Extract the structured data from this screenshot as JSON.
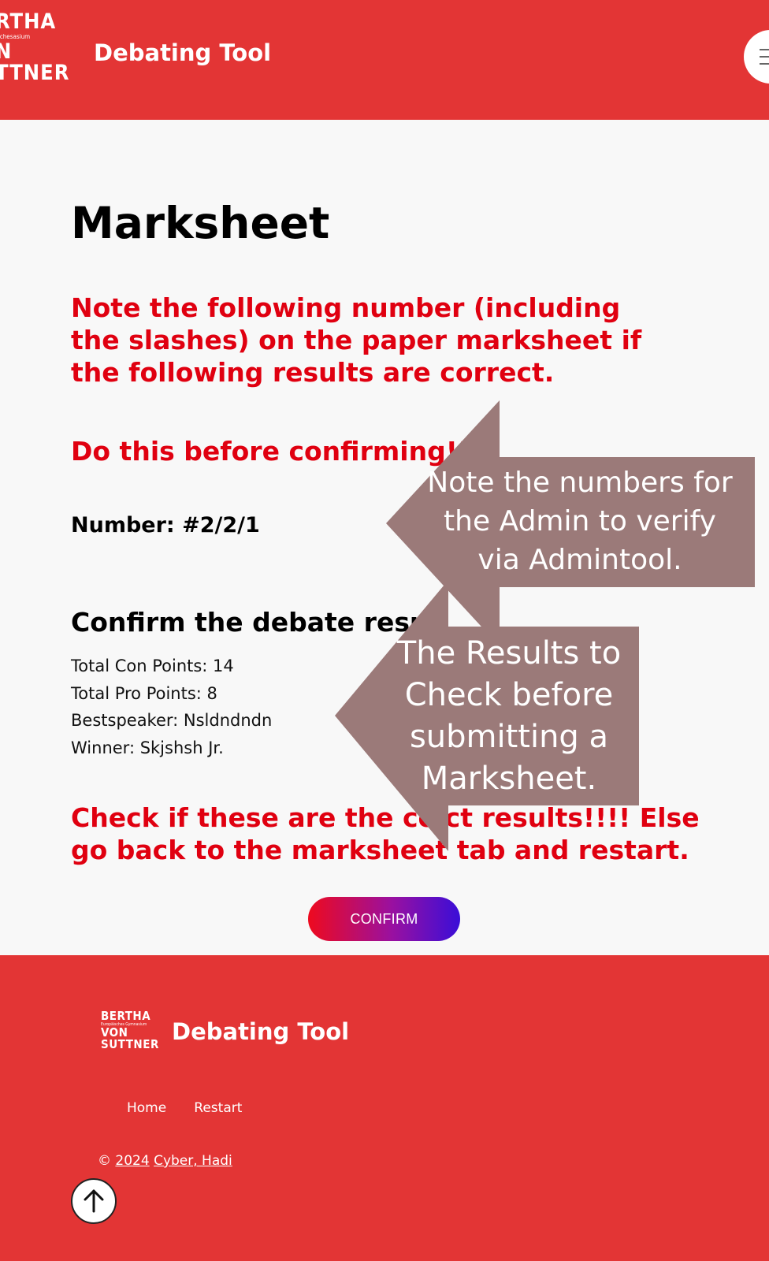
{
  "header": {
    "logo": {
      "line1": "RTHA",
      "line2": "ischesasium",
      "line3": "N",
      "line4": "TTNER"
    },
    "title": "Debating Tool",
    "menu_icon": "hamburger-icon"
  },
  "main": {
    "title": "Marksheet",
    "note_instruction": "Note the following number (including the slashes) on the paper marksheet if the following results are correct.",
    "note_warning": "Do this before confirming!!!",
    "number_label": "Number:",
    "number_value": "#2/2/1",
    "confirm_heading": "Confirm the debate resu",
    "results": [
      "Total Con Points: 14",
      "Total Pro Points: 8",
      "Bestspeaker: Nsldndndn",
      "Winner: Skjshsh Jr."
    ],
    "check_warning": "Check if these are the co ct results!!!! Else go back to the marksheet tab and restart.",
    "confirm_button": "CONFIRM"
  },
  "callouts": [
    {
      "text": "Note the numbers for the Admin to verify via Admintool."
    },
    {
      "text": "The Results to Check before submitting a Marksheet."
    }
  ],
  "footer": {
    "logo": {
      "line1": "BERTHA",
      "line2": "Europäisches Gymnasium",
      "line3": "VON",
      "line4": "SUTTNER"
    },
    "title": "Debating Tool",
    "nav": {
      "home": "Home",
      "restart": "Restart"
    },
    "copyright_symbol": "©",
    "copyright_year": "2024",
    "copyright_authors": "Cyber, Hadi",
    "back_to_top_icon": "arrow-up-icon"
  },
  "colors": {
    "brand_red": "#e33535",
    "warning_red": "#e00010",
    "callout": "#9b7a79",
    "button_gradient": [
      "#ee0a1e",
      "#3a0ed8"
    ]
  }
}
